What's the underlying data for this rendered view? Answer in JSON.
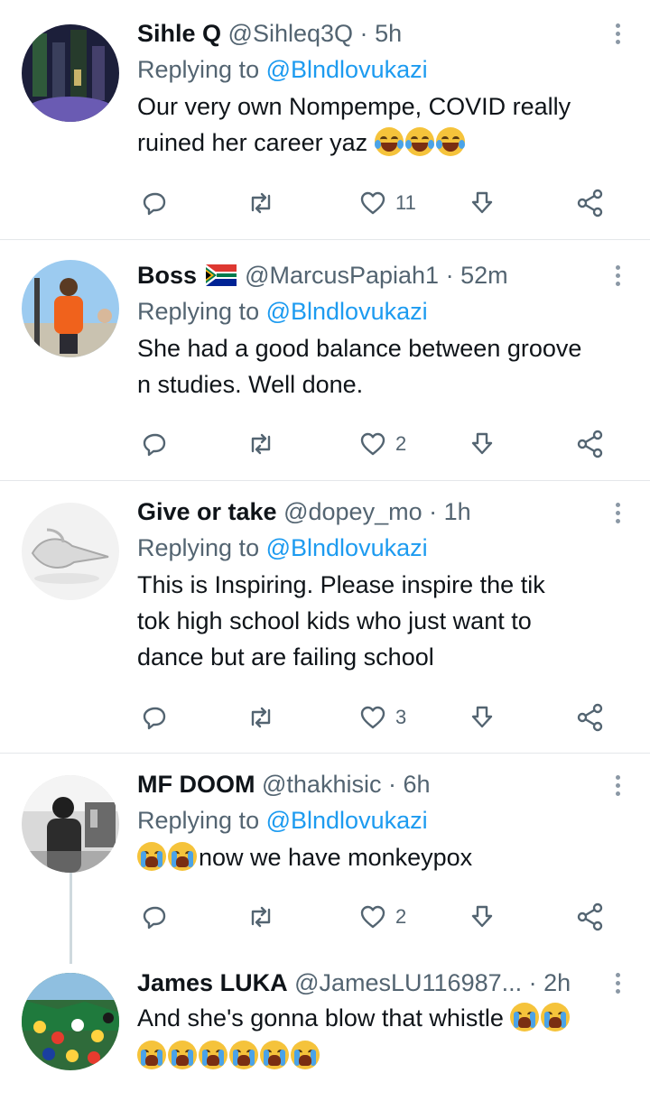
{
  "colors": {
    "accent": "#1d9bf0",
    "secondary_text": "#536471",
    "divider": "#e4e7ea"
  },
  "tweets": [
    {
      "name": "Sihle Q",
      "handle": "@Sihleq3Q",
      "dot": "·",
      "time": "5h",
      "replying_prefix": "Replying to",
      "replying_to": "@Blndlovukazi",
      "lines": [
        "Our very own Nompempe,  COVID really",
        "ruined her career yaz"
      ],
      "emojis": [
        "face-with-tears-of-joy",
        "face-with-tears-of-joy",
        "face-with-tears-of-joy"
      ],
      "likes": "11"
    },
    {
      "name": "Boss",
      "flag": "south-africa-flag-icon",
      "handle": "@MarcusPapiah1",
      "dot": "·",
      "time": "52m",
      "replying_prefix": "Replying to",
      "replying_to": "@Blndlovukazi",
      "lines": [
        "She had a good balance between groove",
        "n studies. Well done."
      ],
      "likes": "2"
    },
    {
      "name": "Give or take",
      "handle": "@dopey_mo",
      "dot": "·",
      "time": "1h",
      "replying_prefix": "Replying to",
      "replying_to": "@Blndlovukazi",
      "lines": [
        "This is Inspiring. Please inspire the tik",
        "tok high school kids who just want to",
        "dance but are failing  school"
      ],
      "likes": "3"
    },
    {
      "name": "MF DOOM",
      "handle": "@thakhisic",
      "dot": "·",
      "time": "6h",
      "replying_prefix": "Replying to",
      "replying_to": "@Blndlovukazi",
      "lines": [
        "now  we have monkeypox"
      ],
      "emojis": [
        "loudly-crying-face",
        "loudly-crying-face"
      ],
      "likes": "2"
    },
    {
      "name": "James LUKA",
      "handle": "@JamesLU116987...",
      "dot": "·",
      "time": "2h",
      "lines": [
        "And she's gonna blow that whistle"
      ],
      "emojis": [
        "loudly-crying-face",
        "loudly-crying-face"
      ],
      "emojis_line2": [
        "loudly-crying-face",
        "loudly-crying-face",
        "loudly-crying-face",
        "loudly-crying-face",
        "loudly-crying-face",
        "loudly-crying-face"
      ]
    }
  ]
}
